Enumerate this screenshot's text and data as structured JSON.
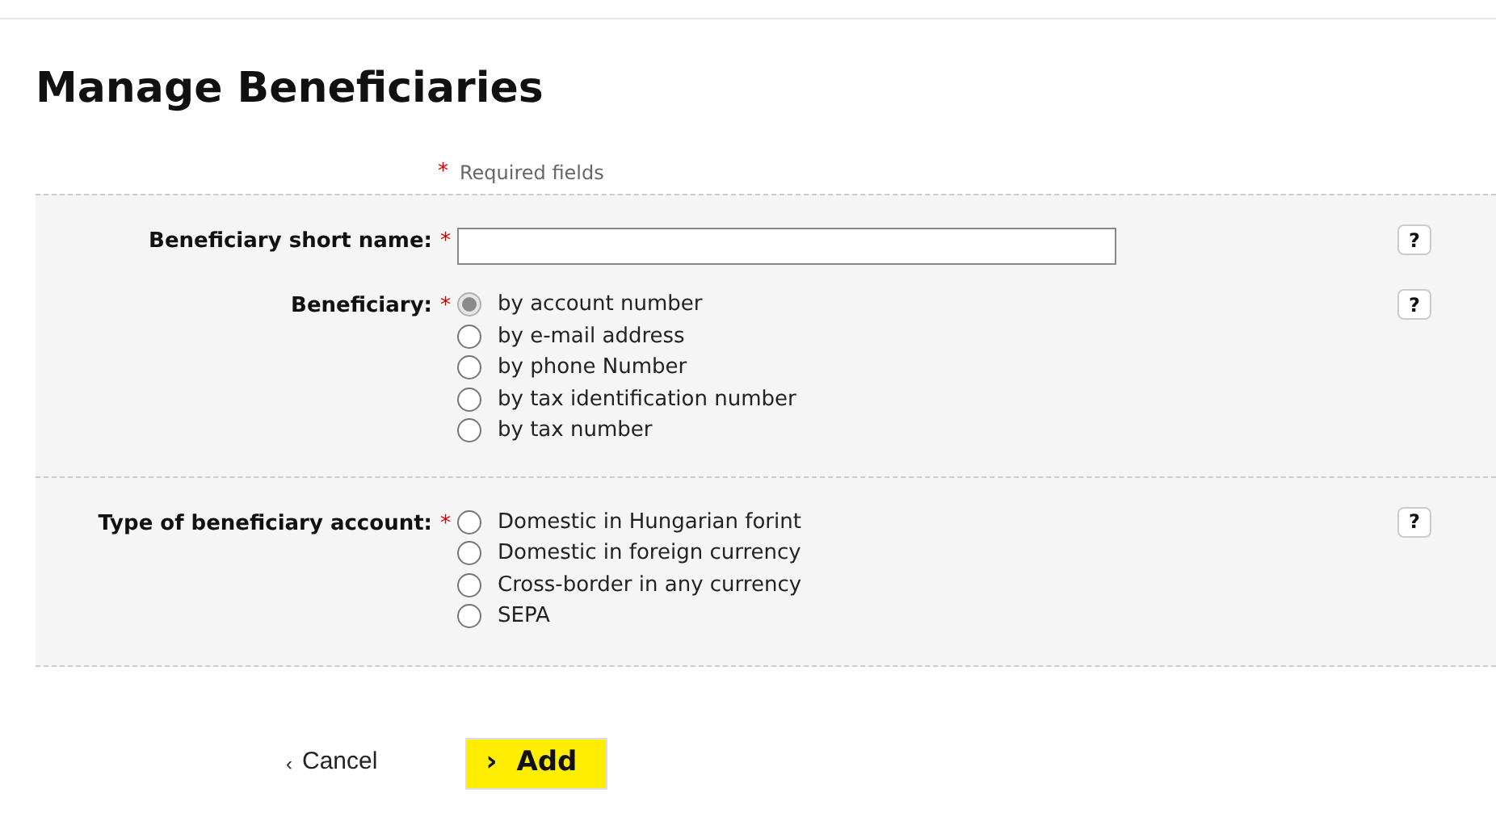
{
  "title": "Manage Beneficiaries",
  "required_note": {
    "mark": "*",
    "text": "Required fields"
  },
  "sections": [
    {
      "rows": [
        {
          "kind": "text",
          "label": "Beneficiary short name:",
          "mark": "*",
          "help": "?",
          "value": ""
        },
        {
          "kind": "radio",
          "label": "Beneficiary:",
          "mark": "*",
          "help": "?",
          "options": [
            {
              "label": "by account number",
              "selected": true,
              "disabled": true
            },
            {
              "label": "by e-mail address",
              "selected": false,
              "disabled": false
            },
            {
              "label": "by phone Number",
              "selected": false,
              "disabled": false
            },
            {
              "label": "by tax identification number",
              "selected": false,
              "disabled": false
            },
            {
              "label": "by tax number",
              "selected": false,
              "disabled": false
            }
          ]
        }
      ]
    },
    {
      "rows": [
        {
          "kind": "radio",
          "label": "Type of beneficiary account:",
          "mark": "*",
          "help": "?",
          "options": [
            {
              "label": "Domestic in Hungarian forint",
              "selected": false,
              "disabled": false
            },
            {
              "label": "Domestic in foreign currency",
              "selected": false,
              "disabled": false
            },
            {
              "label": "Cross-border in any currency",
              "selected": false,
              "disabled": false
            },
            {
              "label": "SEPA",
              "selected": false,
              "disabled": false
            }
          ]
        }
      ]
    }
  ],
  "cancel": {
    "icon": "‹",
    "label": "Cancel"
  },
  "add": {
    "icon": "›",
    "label": "Add"
  }
}
